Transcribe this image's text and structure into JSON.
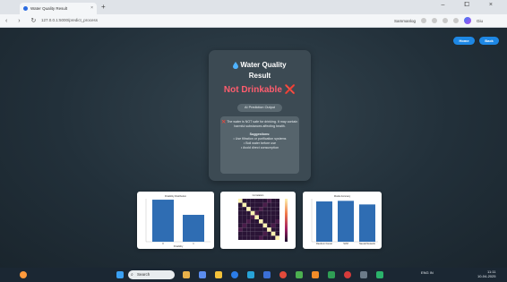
{
  "browser": {
    "tab_title": "Water Quality Result",
    "tab_close": "×",
    "new_tab": "+",
    "url": "127.0.0.1:5000/predict_process",
    "window_controls": "–  ⧠  ×",
    "nav_icons": "‹ › ↻",
    "right_tools": "Sammanlog",
    "profile": "Giu"
  },
  "header": {
    "home_label": "Home",
    "back_label": "Back",
    "accent": "#1e88e5"
  },
  "result": {
    "title_line1": "Water Quality",
    "title_line2": "Result",
    "verdict": "Not Drinkable ❌",
    "prediction_button": "AI Prediction Output",
    "warning": "❌ The water is NOT safe for drinking. It may contain harmful substances affecting health.",
    "suggestions_heading": "Suggestions:",
    "suggestions": [
      "• Use filtration or purification systems",
      "• Boil water before use",
      "• Avoid direct consumption"
    ]
  },
  "charts": [
    {
      "name": "class-distribution-chart",
      "title": "Potability Distribution",
      "xlabel": "Potability",
      "categories": [
        "0",
        "1"
      ]
    },
    {
      "name": "correlation-heatmap",
      "title": "Correlation"
    },
    {
      "name": "model-accuracy-chart",
      "title": "Model Accuracy",
      "categories": [
        "Random Forest",
        "SVM",
        "Neural Network"
      ]
    }
  ],
  "chart_data": [
    {
      "type": "bar",
      "title": "Potability Distribution",
      "categories": [
        "0",
        "1"
      ],
      "values": [
        1998,
        1278
      ],
      "ylim": [
        0,
        2000
      ],
      "xlabel": "Potability"
    },
    {
      "type": "heatmap",
      "title": "Correlation",
      "size": 10
    },
    {
      "type": "bar",
      "title": "Model Accuracy",
      "categories": [
        "Random Forest",
        "SVM",
        "Neural Network"
      ],
      "values": [
        0.67,
        0.68,
        0.62
      ],
      "ylim": [
        0,
        0.7
      ]
    }
  ],
  "taskbar": {
    "search_placeholder": "Search",
    "tray_text": "ENG IN",
    "time": "11:11",
    "date": "10-04-2025"
  }
}
